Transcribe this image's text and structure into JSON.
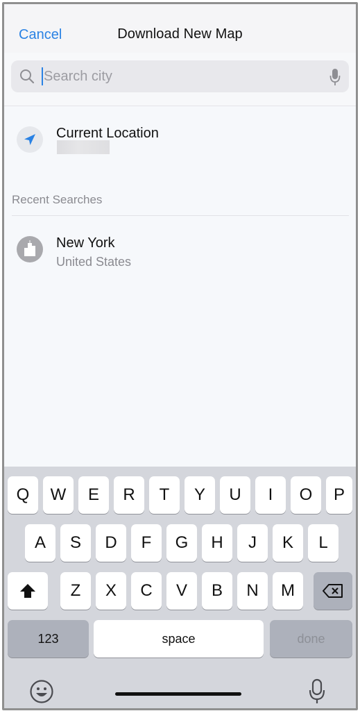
{
  "nav": {
    "cancel_label": "Cancel",
    "title": "Download New Map"
  },
  "search": {
    "placeholder": "Search city",
    "value": ""
  },
  "current_location": {
    "label": "Current Location",
    "icon": "location-arrow-icon"
  },
  "recent": {
    "header": "Recent Searches",
    "items": [
      {
        "city": "New York",
        "country": "United States",
        "icon": "city-icon"
      }
    ]
  },
  "keyboard": {
    "row1": [
      "Q",
      "W",
      "E",
      "R",
      "T",
      "Y",
      "U",
      "I",
      "O",
      "P"
    ],
    "row2": [
      "A",
      "S",
      "D",
      "F",
      "G",
      "H",
      "J",
      "K",
      "L"
    ],
    "row3": [
      "Z",
      "X",
      "C",
      "V",
      "B",
      "N",
      "M"
    ],
    "numbers_label": "123",
    "space_label": "space",
    "done_label": "done"
  },
  "colors": {
    "accent": "#2a82e4",
    "keyboard_bg": "#d4d6dc",
    "dark_key": "#adb1bb"
  }
}
